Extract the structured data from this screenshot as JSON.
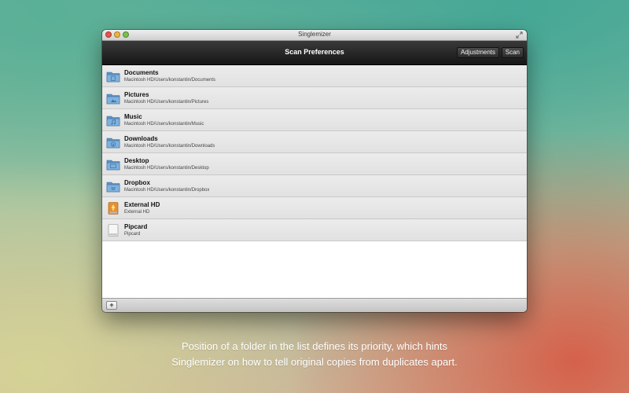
{
  "window": {
    "title": "Singlemizer",
    "controls": [
      "close-icon",
      "minimize-icon",
      "zoom-icon",
      "fullscreen-icon"
    ]
  },
  "toolbar": {
    "title": "Scan Preferences",
    "adjustments_label": "Adjustments",
    "scan_label": "Scan"
  },
  "folders": [
    {
      "name": "Documents",
      "path": "Macintosh HD/Users/konstantin/Documents",
      "icon": "documents-folder-icon"
    },
    {
      "name": "Pictures",
      "path": "Macintosh HD/Users/konstantin/Pictures",
      "icon": "pictures-folder-icon"
    },
    {
      "name": "Music",
      "path": "Macintosh HD/Users/konstantin/Music",
      "icon": "music-folder-icon"
    },
    {
      "name": "Downloads",
      "path": "Macintosh HD/Users/konstantin/Downloads",
      "icon": "downloads-folder-icon"
    },
    {
      "name": "Desktop",
      "path": "Macintosh HD/Users/konstantin/Desktop",
      "icon": "desktop-folder-icon"
    },
    {
      "name": "Dropbox",
      "path": "Macintosh HD/Users/konstantin/Dropbox",
      "icon": "dropbox-folder-icon"
    },
    {
      "name": "External HD",
      "path": "External HD",
      "icon": "external-drive-icon"
    },
    {
      "name": "Pipcard",
      "path": "Pipcard",
      "icon": "removable-drive-icon"
    }
  ],
  "bottombar": {
    "add_label": "+"
  },
  "caption": {
    "line1": "Position of a folder in the list defines its priority, which hints",
    "line2": "Singlemizer on how to tell original copies from duplicates apart."
  },
  "colors": {
    "folder": "#6fa3d3",
    "toolbar": "#1e1e1e",
    "external_drive": "#e8902a"
  }
}
